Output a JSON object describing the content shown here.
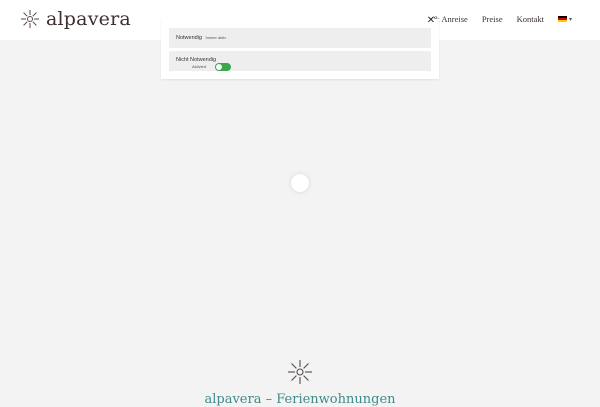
{
  "header": {
    "logo_text": "alpavera",
    "logo_icon": "sun-flower-icon",
    "nav": {
      "anreise": "& Anreise",
      "preise": "Preise",
      "kontakt": "Kontakt"
    },
    "language_icon": "german-flag-icon"
  },
  "consent": {
    "close_icon": "close-icon",
    "categories": [
      {
        "title": "Notwendig",
        "status": "Immer aktiv"
      },
      {
        "title": "Nicht Notwendig",
        "status": "Aktiviert",
        "enabled": true
      }
    ]
  },
  "footer": {
    "title": "alpavera – Ferienwohnungen",
    "icon": "sun-flower-icon"
  },
  "colors": {
    "background": "#f3f3f3",
    "toggle_on": "#3aa84a",
    "footer_title": "#3f8a8a"
  }
}
